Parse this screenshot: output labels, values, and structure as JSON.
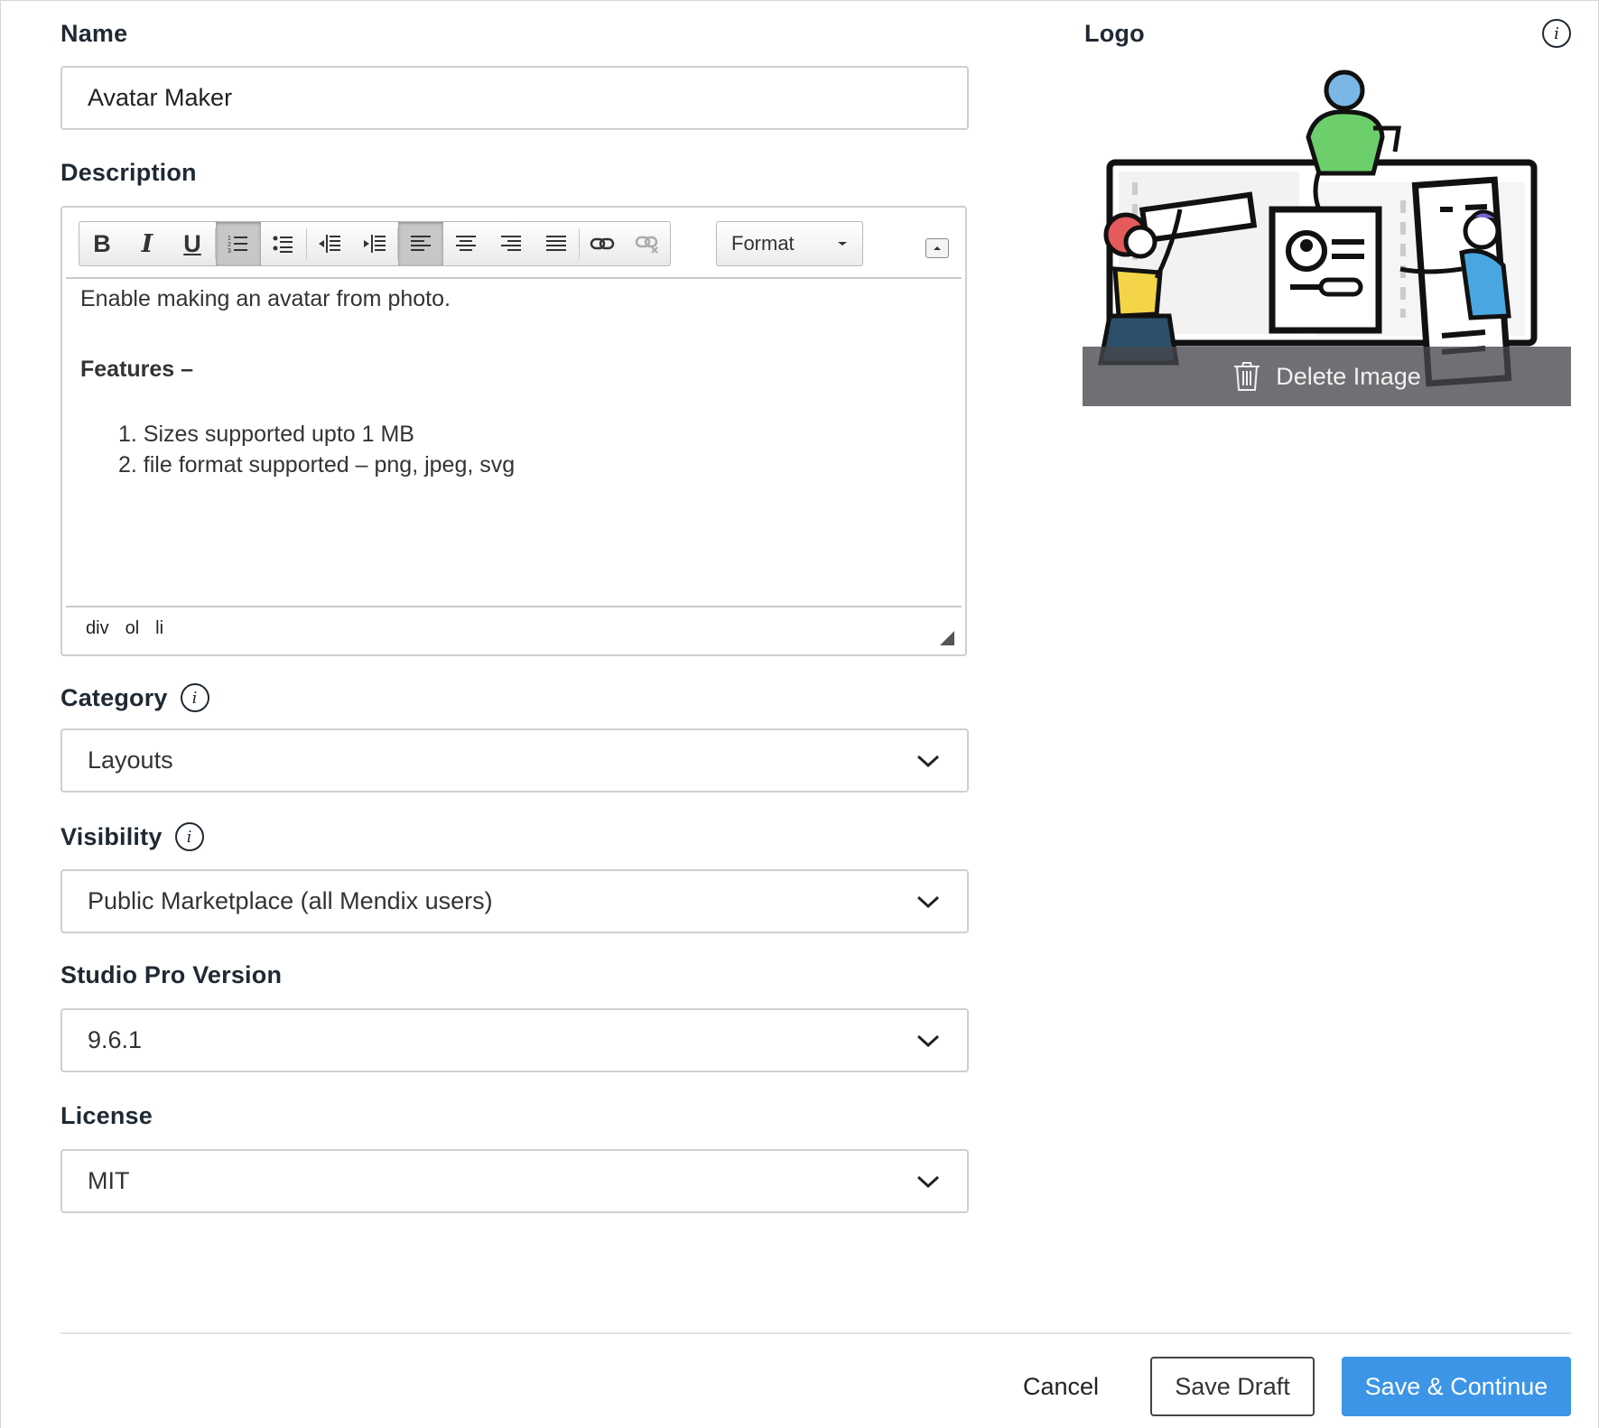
{
  "form": {
    "name": {
      "label": "Name",
      "value": "Avatar Maker"
    },
    "description": {
      "label": "Description",
      "format_label": "Format",
      "content": {
        "line1": "Enable making an avatar from photo.",
        "line2": "Features –",
        "list": [
          "1. Sizes supported upto 1 MB",
          "2. file format supported – png, jpeg, svg"
        ]
      },
      "element_path": [
        "div",
        "ol",
        "li"
      ]
    },
    "category": {
      "label": "Category",
      "value": "Layouts"
    },
    "visibility": {
      "label": "Visibility",
      "value": "Public Marketplace (all Mendix users)"
    },
    "studio_pro_version": {
      "label": "Studio Pro Version",
      "value": "9.6.1"
    },
    "license": {
      "label": "License",
      "value": "MIT"
    }
  },
  "logo": {
    "label": "Logo",
    "delete_label": "Delete Image"
  },
  "toolbar_icons": [
    "bold",
    "italic",
    "underline",
    "ordered-list",
    "unordered-list",
    "outdent",
    "indent",
    "align-left",
    "align-center",
    "align-right",
    "align-justify",
    "link",
    "unlink"
  ],
  "footer": {
    "cancel_label": "Cancel",
    "save_draft_label": "Save Draft",
    "save_continue_label": "Save & Continue"
  },
  "colors": {
    "primary": "#3c95e6",
    "border": "#cfcfcf"
  }
}
